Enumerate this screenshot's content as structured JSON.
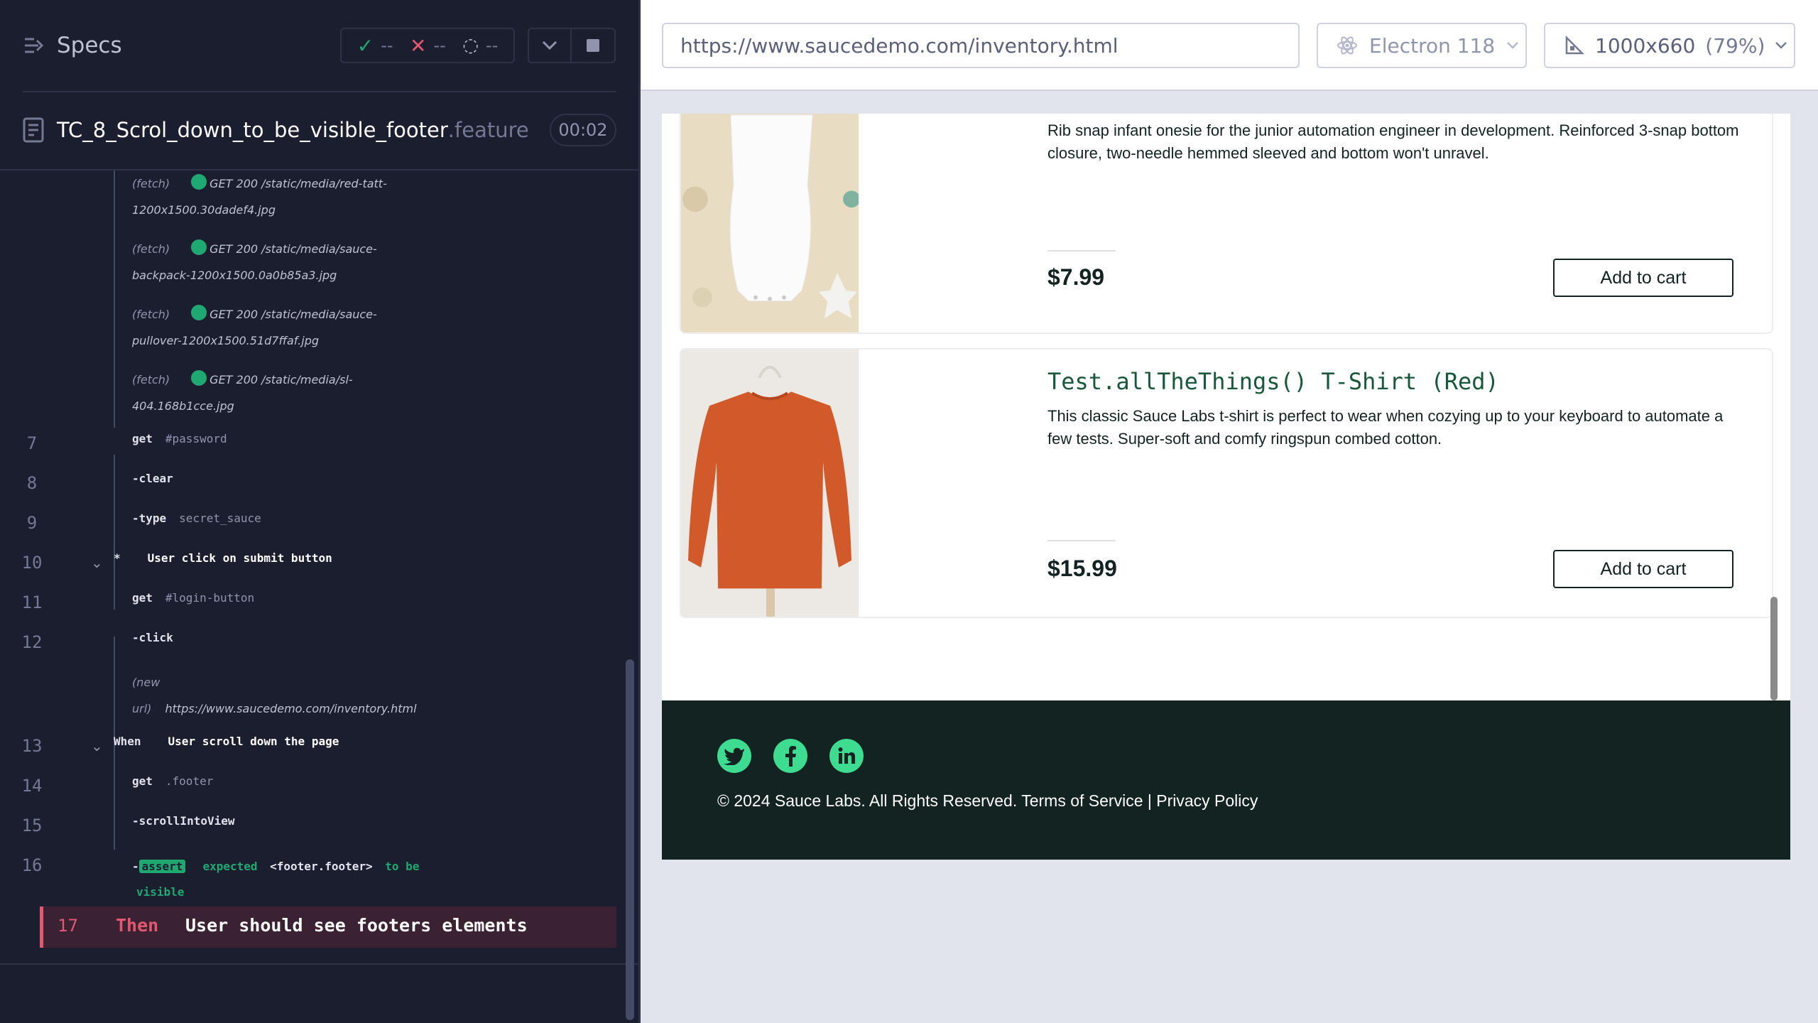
{
  "runner": {
    "specs_label": "Specs",
    "stats": {
      "passed": "--",
      "failed": "--",
      "pending": "--"
    },
    "spec": {
      "name": "TC_8_Scrol_down_to_be_visible_footer",
      "ext": ".feature",
      "duration": "00:02"
    }
  },
  "log": {
    "fetches": [
      {
        "line1_label": "(fetch)",
        "line1": "GET 200 /static/media/red-tatt-",
        "line2": "1200x1500.30dadef4.jpg"
      },
      {
        "line1_label": "(fetch)",
        "line1": "GET 200 /static/media/sauce-",
        "line2": "backpack-1200x1500.0a0b85a3.jpg"
      },
      {
        "line1_label": "(fetch)",
        "line1": "GET 200 /static/media/sauce-",
        "line2": "pullover-1200x1500.51d7ffaf.jpg"
      },
      {
        "line1_label": "(fetch)",
        "line1": "GET 200 /static/media/sl-",
        "line2": "404.168b1cce.jpg"
      }
    ],
    "line7": {
      "num": "7",
      "cmd": "get",
      "arg": "#password"
    },
    "line8": {
      "num": "8",
      "cmd": "-clear"
    },
    "line9": {
      "num": "9",
      "cmd": "-type",
      "arg": "secret_sauce"
    },
    "line10": {
      "num": "10",
      "keyword": "*",
      "text": "User click on submit button"
    },
    "line11": {
      "num": "11",
      "cmd": "get",
      "arg": "#login-button"
    },
    "line12": {
      "num": "12",
      "cmd": "-click"
    },
    "new_url": {
      "label1": "(new",
      "label2": "url)",
      "url": "https://www.saucedemo.com/inventory.html"
    },
    "line13": {
      "num": "13",
      "keyword": "When",
      "text": "User scroll down the page"
    },
    "line14": {
      "num": "14",
      "cmd": "get",
      "arg": ".footer"
    },
    "line15": {
      "num": "15",
      "cmd": "-scrollIntoView"
    },
    "line16": {
      "num": "16",
      "dash": "-",
      "badge": "assert",
      "expected": "expected",
      "subject": "<footer.footer>",
      "to_be": "to be",
      "visible": "visible"
    },
    "line17": {
      "num": "17",
      "keyword": "Then",
      "text": "User should see footers elements"
    }
  },
  "toolbar": {
    "url": "https://www.saucedemo.com/inventory.html",
    "browser": "Electron 118",
    "viewport": "1000x660",
    "viewport_pct": "(79%)"
  },
  "aut": {
    "items": [
      {
        "desc": "Rib snap infant onesie for the junior automation engineer in development. Reinforced 3-snap bottom closure, two-needle hemmed sleeved and bottom won't unravel.",
        "price": "$7.99",
        "button": "Add to cart"
      },
      {
        "title": "Test.allTheThings() T-Shirt (Red)",
        "desc": "This classic Sauce Labs t-shirt is perfect to wear when cozying up to your keyboard to automate a few tests. Super-soft and comfy ringspun combed cotton.",
        "price": "$15.99",
        "button": "Add to cart"
      }
    ],
    "footer": {
      "copyright": "© 2024 Sauce Labs. All Rights Reserved. Terms of Service | Privacy Policy",
      "social": [
        "twitter-icon",
        "facebook-icon",
        "linkedin-icon"
      ],
      "accent": "#3ddc91"
    }
  }
}
